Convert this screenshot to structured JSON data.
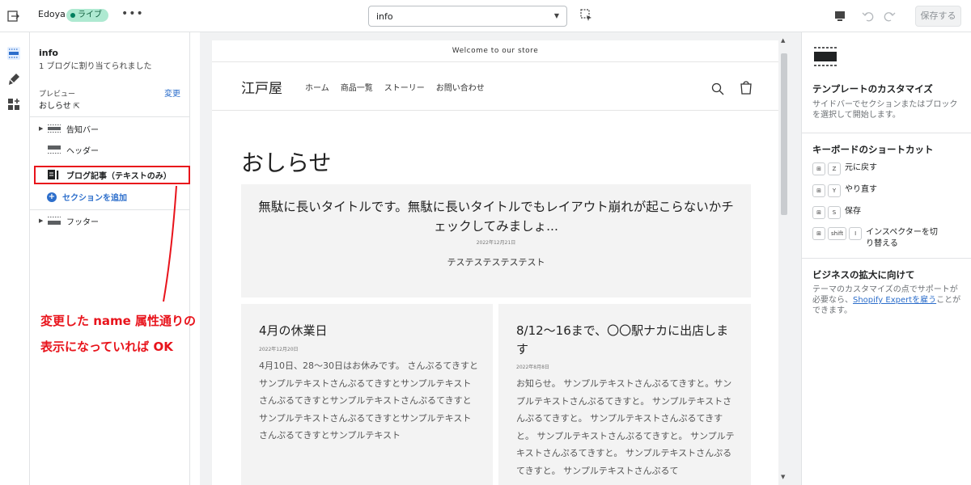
{
  "topbar": {
    "store_name": "Edoya",
    "status_badge": "ライブ",
    "more": "•••",
    "template_select": "info",
    "save_label": "保存する"
  },
  "sidebar": {
    "template_title": "info",
    "template_sub": "1 ブログに割り当てられました",
    "preview_label": "プレビュー",
    "preview_value": "おしらせ",
    "change_label": "変更",
    "sections": [
      {
        "label": "告知バー"
      },
      {
        "label": "ヘッダー"
      },
      {
        "label": "ブログ記事（テキストのみ）"
      },
      {
        "label": "フッター"
      }
    ],
    "add_section": "セクションを追加"
  },
  "annotation": {
    "line1": "変更した name 属性通りの",
    "line2": "表示になっていれば OK"
  },
  "preview": {
    "announcement": "Welcome to our store",
    "logo": "江戸屋",
    "nav": [
      "ホーム",
      "商品一覧",
      "ストーリー",
      "お問い合わせ"
    ],
    "page_title": "おしらせ",
    "featured": {
      "title": "無駄に長いタイトルです。無駄に長いタイトルでもレイアウト崩れが起こらないかチェックしてみましょ...",
      "date": "2022年12月21日",
      "excerpt": "テステステステステスト"
    },
    "posts": [
      {
        "title": "4月の休業日",
        "date": "2022年12月20日",
        "excerpt": "4月10日、28～30日はお休みです。 さんぷるてきすとサンプルテキストさんぷるてきすとサンプルテキストさんぷるてきすとサンプルテキストさんぷるてきすとサンプルテキストさんぷるてきすとサンプルテキストさんぷるてきすとサンプルテキスト"
      },
      {
        "title": "8/12～16まで、〇〇駅ナカに出店します",
        "date": "2022年8月8日",
        "excerpt": "お知らせ。 サンプルテキストさんぷるてきすと。サンプルテキストさんぷるてきすと。 サンプルテキストさんぷるてきすと。 サンプルテキストさんぷるてきすと。 サンプルテキストさんぷるてきすと。 サンプルテキストさんぷるてきすと。 サンプルテキストさんぷるてきすと。 サンプルテキストさんぷるて"
      }
    ]
  },
  "right_panel": {
    "customize_title": "テンプレートのカスタマイズ",
    "customize_desc": "サイドバーでセクションまたはブロックを選択して開始します。",
    "shortcuts_title": "キーボードのショートカット",
    "shortcuts": [
      {
        "keys": [
          "⊞",
          "Z"
        ],
        "label": "元に戻す"
      },
      {
        "keys": [
          "⊞",
          "Y"
        ],
        "label": "やり直す"
      },
      {
        "keys": [
          "⊞",
          "S"
        ],
        "label": "保存"
      },
      {
        "keys": [
          "⊞",
          "shift",
          "I"
        ],
        "label": "インスペクターを切り替える"
      }
    ],
    "grow_title": "ビジネスの拡大に向けて",
    "grow_desc_pre": "テーマのカスタマイズの点でサポートが必要なら、",
    "grow_link": "Shopify Expertを雇う",
    "grow_desc_post": "ことができます。"
  }
}
